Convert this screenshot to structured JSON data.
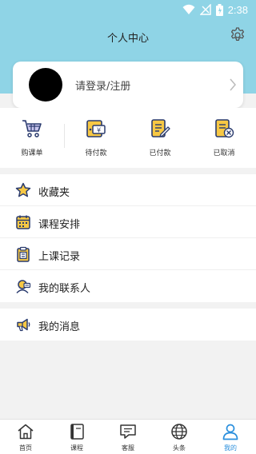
{
  "status_bar": {
    "time": "2:38"
  },
  "header": {
    "title": "个人中心",
    "settings_icon": "gear-icon"
  },
  "login_card": {
    "text": "请登录/注册",
    "chevron_icon": "chevron-right-icon"
  },
  "orders": [
    {
      "label": "购课单",
      "icon": "cart-icon"
    },
    {
      "label": "待付款",
      "icon": "wallet-yen-icon"
    },
    {
      "label": "已付款",
      "icon": "paid-document-icon"
    },
    {
      "label": "已取消",
      "icon": "cancelled-document-icon"
    }
  ],
  "menu": [
    {
      "label": "收藏夹",
      "icon": "star-icon"
    },
    {
      "label": "课程安排",
      "icon": "calendar-icon"
    },
    {
      "label": "上课记录",
      "icon": "clipboard-icon"
    },
    {
      "label": "我的联系人",
      "icon": "contact-icon"
    }
  ],
  "menu_secondary": [
    {
      "label": "我的消息",
      "icon": "megaphone-icon"
    }
  ],
  "tabs": [
    {
      "label": "首页",
      "icon": "home-icon"
    },
    {
      "label": "课程",
      "icon": "book-icon"
    },
    {
      "label": "客服",
      "icon": "chat-icon"
    },
    {
      "label": "头条",
      "icon": "globe-icon"
    },
    {
      "label": "我的",
      "icon": "person-icon",
      "active": true
    }
  ],
  "colors": {
    "header": "#8fd4e6",
    "accent": "#2a8fdd",
    "icon_navy": "#2a3b6e",
    "icon_yellow": "#f7c844"
  }
}
